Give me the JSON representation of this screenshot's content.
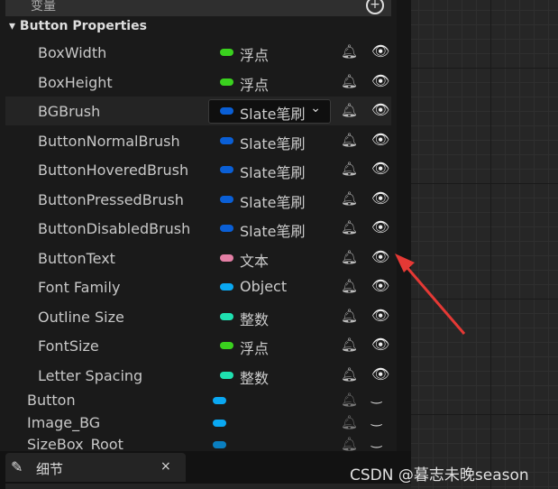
{
  "header": {
    "title": "变量",
    "add_icon": "plus-circle-icon"
  },
  "category": "Button Properties",
  "properties": [
    {
      "name": "BoxWidth",
      "type": "浮点",
      "color": "#3ad11e"
    },
    {
      "name": "BoxHeight",
      "type": "浮点",
      "color": "#3ad11e"
    },
    {
      "name": "BGBrush",
      "type": "Slate笔刷",
      "color": "#0a5fd6",
      "selected": true
    },
    {
      "name": "ButtonNormalBrush",
      "type": "Slate笔刷",
      "color": "#0a5fd6"
    },
    {
      "name": "ButtonHoveredBrush",
      "type": "Slate笔刷",
      "color": "#0a5fd6"
    },
    {
      "name": "ButtonPressedBrush",
      "type": "Slate笔刷",
      "color": "#0a5fd6"
    },
    {
      "name": "ButtonDisabledBrush",
      "type": "Slate笔刷",
      "color": "#0a5fd6"
    },
    {
      "name": "ButtonText",
      "type": "文本",
      "color": "#e47fa5"
    },
    {
      "name": "Font Family",
      "type": "Object",
      "color": "#0aa8f2"
    },
    {
      "name": "Outline Size",
      "type": "整数",
      "color": "#1fe0b0"
    },
    {
      "name": "FontSize",
      "type": "浮点",
      "color": "#3ad11e"
    },
    {
      "name": "Letter Spacing",
      "type": "整数",
      "color": "#1fe0b0"
    }
  ],
  "widgets": [
    {
      "name": "Button",
      "color": "#0aa8f2"
    },
    {
      "name": "Image_BG",
      "color": "#0aa8f2"
    },
    {
      "name": "SizeBox_Root",
      "color": "#0a7fc0"
    }
  ],
  "tab": {
    "label": "细节",
    "close": "×"
  },
  "watermark": "CSDN @暮志未晚season",
  "annotation_color": "#e53935"
}
